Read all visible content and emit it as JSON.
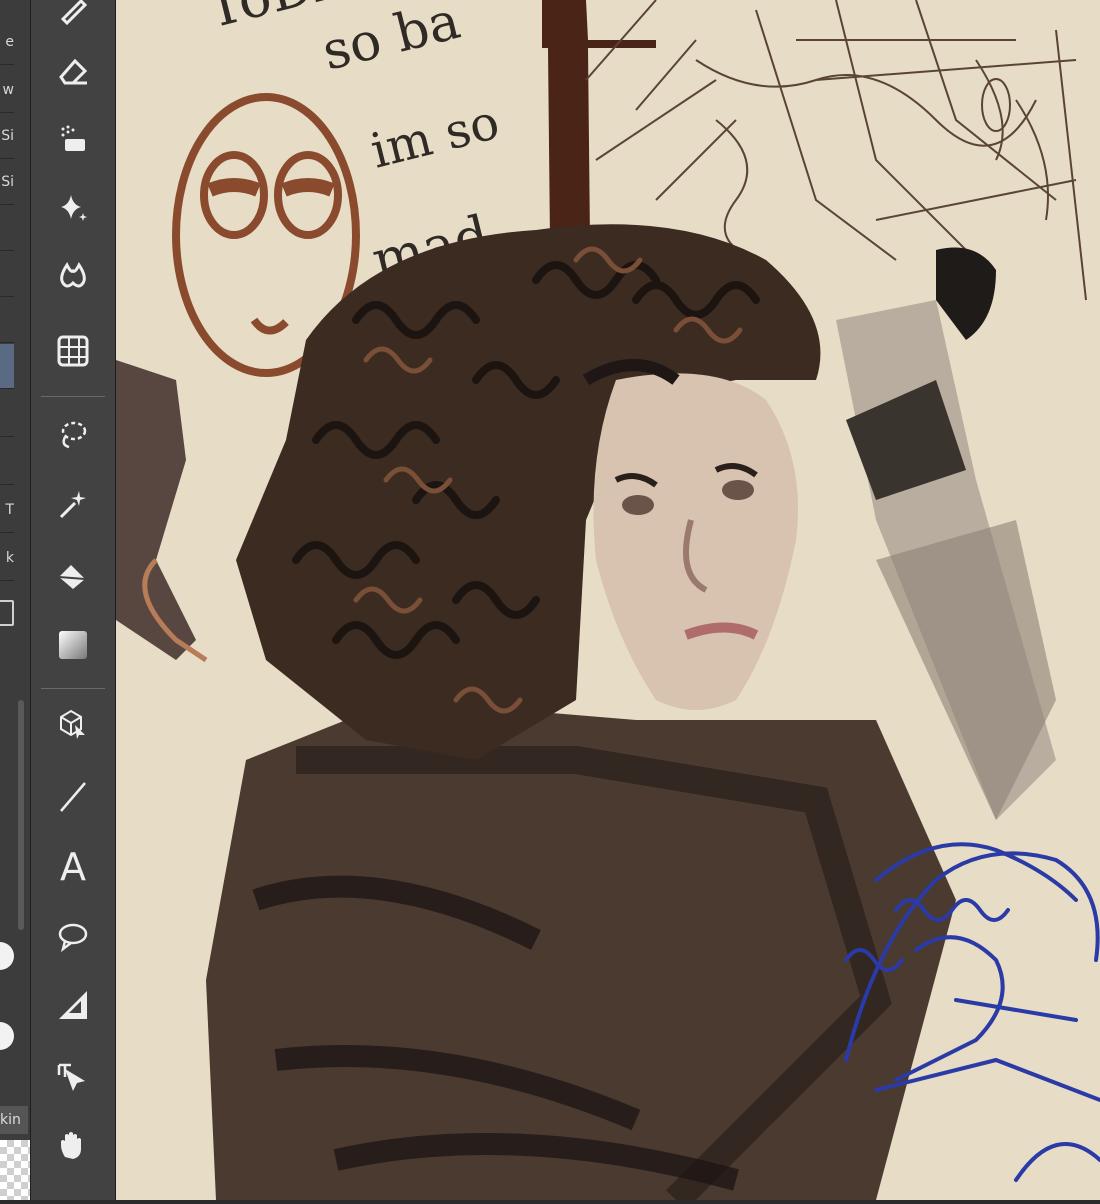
{
  "layer_panel": {
    "partial_labels": [
      "e",
      "w",
      "Si",
      "Si",
      "T",
      "k"
    ],
    "skin_label": "kin"
  },
  "toolbar": {
    "tools": [
      {
        "name": "pen-tool"
      },
      {
        "name": "eraser-tool"
      },
      {
        "name": "blend-tool"
      },
      {
        "name": "decoration-tool"
      },
      {
        "name": "fill-drop-tool"
      },
      {
        "name": "grid-tool"
      },
      {
        "name": "lasso-tool"
      },
      {
        "name": "auto-select-tool"
      },
      {
        "name": "fill-bucket-tool"
      },
      {
        "name": "gradient-tool"
      },
      {
        "name": "operation-3d-tool"
      },
      {
        "name": "line-tool"
      },
      {
        "name": "text-tool"
      },
      {
        "name": "balloon-tool"
      },
      {
        "name": "ruler-tool"
      },
      {
        "name": "move-tool"
      },
      {
        "name": "hand-tool"
      }
    ],
    "text_tool_glyph": "A"
  },
  "canvas": {
    "handwriting": [
      "ToDA",
      "so ba",
      "im so",
      "mad"
    ],
    "colors": {
      "paper": "#e7dcc5",
      "rust": "#8a4a2e",
      "dark_brown": "#3a2a20",
      "ink_blue": "#2a3aa6",
      "sketch_brown": "#4a3a30"
    }
  }
}
